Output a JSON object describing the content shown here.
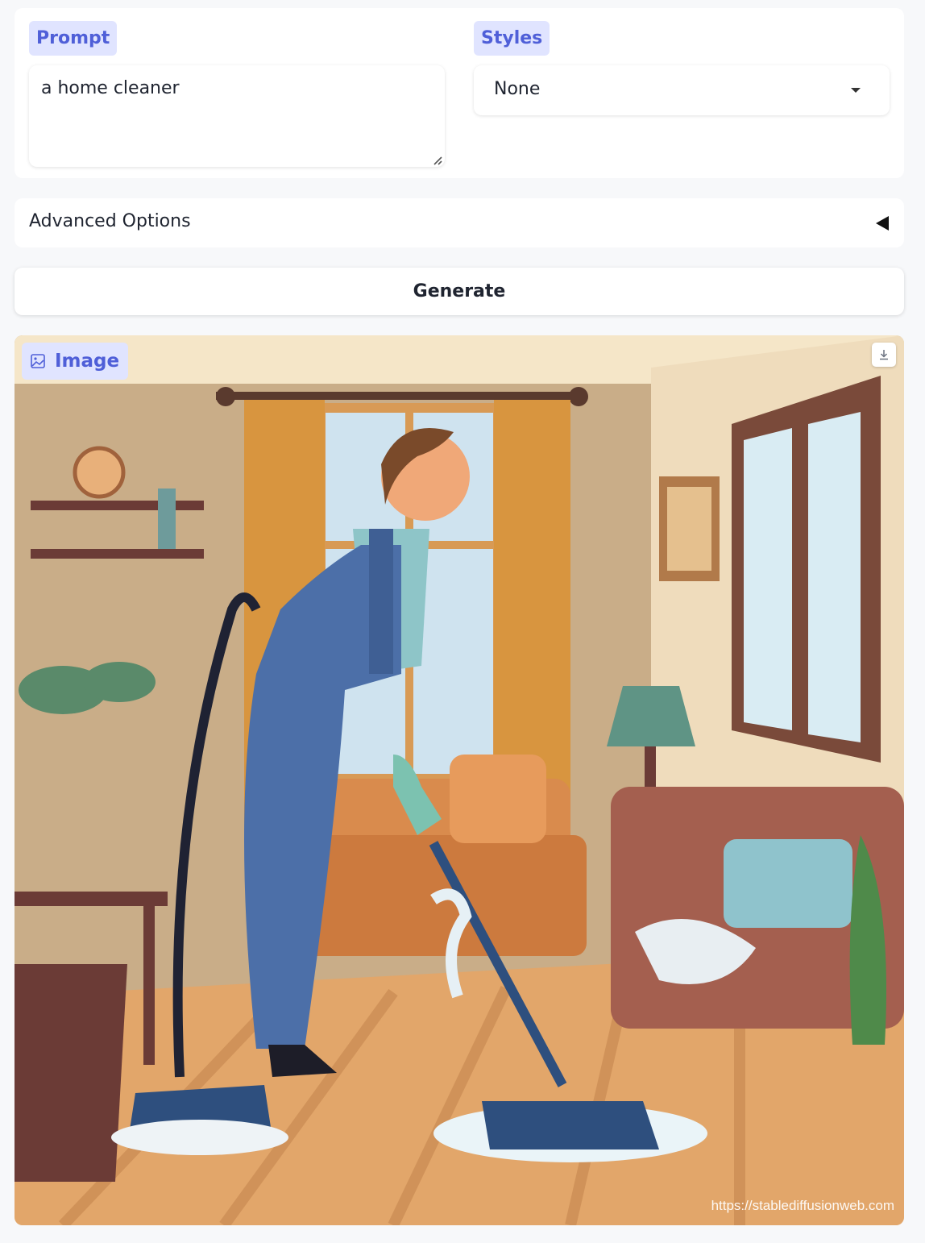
{
  "prompt": {
    "label": "Prompt",
    "value": "a home cleaner"
  },
  "styles": {
    "label": "Styles",
    "selected": "None"
  },
  "advanced": {
    "label": "Advanced Options"
  },
  "generate": {
    "label": "Generate"
  },
  "output": {
    "label": "Image",
    "label_icon": "image-icon",
    "download_icon": "download-icon",
    "watermark": "https://stablediffusionweb.com",
    "image_description": "Flat illustration of a smiling woman in blue overalls and green gloves mopping a wooden floor in a living room with a sofa, lamp, shelves, window and plants"
  },
  "colors": {
    "accent": "#4f5fd8",
    "label_bg": "#e0e4ff",
    "page_bg": "#f7f8fa"
  }
}
